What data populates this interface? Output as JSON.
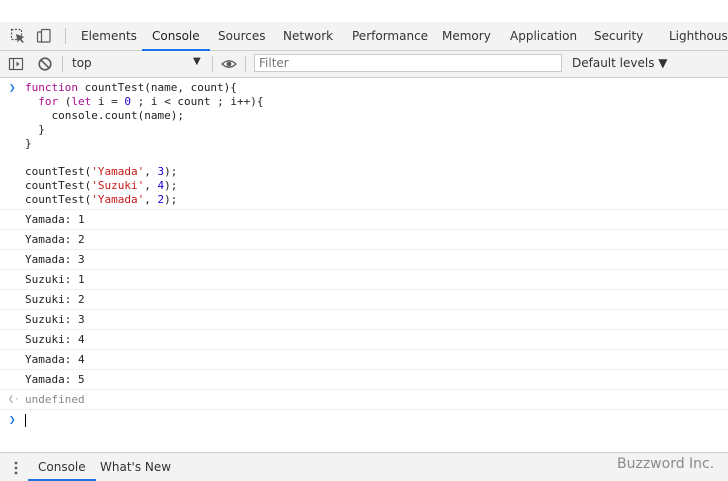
{
  "tabs": [
    {
      "label": "Elements"
    },
    {
      "label": "Console"
    },
    {
      "label": "Sources"
    },
    {
      "label": "Network"
    },
    {
      "label": "Performance"
    },
    {
      "label": "Memory"
    },
    {
      "label": "Application"
    },
    {
      "label": "Security"
    },
    {
      "label": "Lighthouse"
    }
  ],
  "active_tab": "Console",
  "toolbar": {
    "context": "top",
    "filter_placeholder": "Filter",
    "filter_value": "",
    "levels": "Default levels ▼"
  },
  "console": {
    "command_lines": [
      "function countTest(name, count){",
      "  for (let i = 0 ; i < count ; i++){",
      "    console.count(name);",
      "  }",
      "}",
      "",
      "countTest('Yamada', 3);",
      "countTest('Suzuki', 4);",
      "countTest('Yamada', 2);"
    ],
    "logs": [
      "Yamada: 1",
      "Yamada: 2",
      "Yamada: 3",
      "Suzuki: 1",
      "Suzuki: 2",
      "Suzuki: 3",
      "Suzuki: 4",
      "Yamada: 4",
      "Yamada: 5"
    ],
    "result": "undefined",
    "input_value": ""
  },
  "drawer": {
    "tabs": [
      {
        "label": "Console"
      },
      {
        "label": "What's New"
      }
    ],
    "active": "Console"
  },
  "watermark": "Buzzword Inc.",
  "colors": {
    "accent": "#1a73e8",
    "keyword": "#aa0d91",
    "string": "#c41a16",
    "number": "#1c00cf"
  },
  "icons": [
    "inspect-element-icon",
    "device-toolbar-icon",
    "sidebar-toggle-icon",
    "clear-console-icon",
    "dropdown-arrow-icon",
    "eye-icon",
    "kebab-menu-icon",
    "prompt-icon",
    "result-arrow-icon"
  ]
}
